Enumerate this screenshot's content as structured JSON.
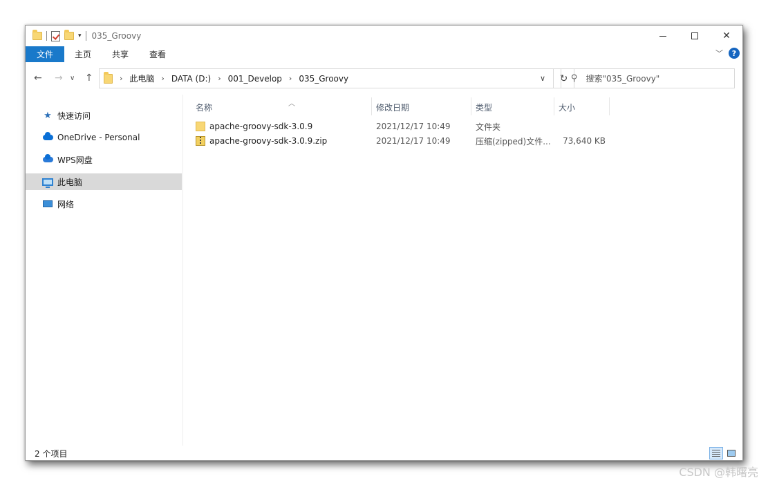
{
  "window": {
    "title": "035_Groovy"
  },
  "ribbon": {
    "tabs": [
      "文件",
      "主页",
      "共享",
      "查看"
    ]
  },
  "address": {
    "crumbs": [
      "此电脑",
      "DATA (D:)",
      "001_Develop",
      "035_Groovy"
    ]
  },
  "search": {
    "placeholder": "搜索\"035_Groovy\""
  },
  "nav": {
    "items": [
      {
        "label": "快速访问",
        "icon": "star-icon"
      },
      {
        "label": "OneDrive - Personal",
        "icon": "onedrive-cloud-icon"
      },
      {
        "label": "WPS网盘",
        "icon": "wps-cloud-icon"
      },
      {
        "label": "此电脑",
        "icon": "computer-icon",
        "selected": true
      },
      {
        "label": "网络",
        "icon": "network-icon"
      }
    ]
  },
  "columns": {
    "name": "名称",
    "date": "修改日期",
    "type": "类型",
    "size": "大小"
  },
  "files": [
    {
      "name": "apache-groovy-sdk-3.0.9",
      "date": "2021/12/17 10:49",
      "type": "文件夹",
      "size": "",
      "icon": "folder-icon"
    },
    {
      "name": "apache-groovy-sdk-3.0.9.zip",
      "date": "2021/12/17 10:49",
      "type": "压缩(zipped)文件...",
      "size": "73,640 KB",
      "icon": "zip-icon"
    }
  ],
  "status": {
    "count": "2 个项目"
  },
  "watermark": "CSDN @韩曙亮",
  "colors": {
    "file_tab": "#1979ca",
    "selected_nav": "#d9d9d9"
  }
}
